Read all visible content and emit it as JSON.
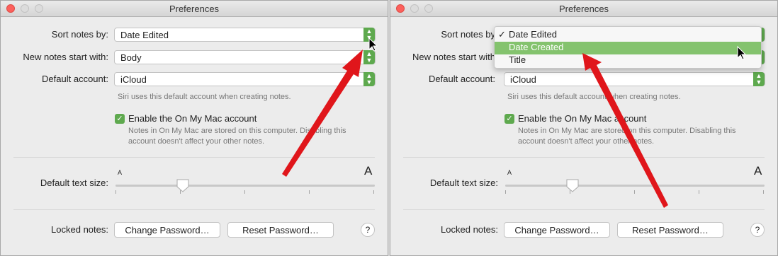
{
  "window": {
    "title": "Preferences"
  },
  "labels": {
    "sort_notes_by": "Sort notes by:",
    "new_notes_start_with": "New notes start with:",
    "default_account": "Default account:",
    "default_text_size": "Default text size:",
    "locked_notes": "Locked notes:"
  },
  "right_labels": {
    "sort_notes_by": "Sort notes by",
    "new_notes_start_with": "New notes start with"
  },
  "values": {
    "sort_notes_by": "Date Edited",
    "new_notes_start_with": "Body",
    "default_account": "iCloud"
  },
  "hints": {
    "account": "Siri uses this default account when creating notes.",
    "on_my_mac_line1": "Notes in On My Mac are stored on this computer. Disabling this",
    "on_my_mac_line2": "account doesn't affect your other notes.",
    "right_on_my_mac_line1": "Notes in On My Mac are stored on this computer. Disabling this",
    "right_on_my_mac_line2": "account doesn't affect your other notes."
  },
  "checkbox": {
    "label": "Enable the On My Mac account",
    "right_label": "Enable the On My Mac account",
    "checked": true
  },
  "text_size": {
    "small_label": "A",
    "large_label": "A",
    "level_fraction": 0.26,
    "tick_count": 5
  },
  "buttons": {
    "change_password": "Change Password…",
    "reset_password": "Reset Password…",
    "help": "?"
  },
  "sort_menu": {
    "items": [
      "Date Edited",
      "Date Created",
      "Title"
    ],
    "checked_item": "Date Edited",
    "highlighted_item": "Date Created",
    "check_mark": "✓"
  },
  "colors": {
    "accent_green": "#5ea94e",
    "highlight_green": "#84c36e",
    "arrow_red": "#e0161b"
  },
  "icons": {
    "stepper": "up-down-chevron-icon",
    "checkbox": "checkmark-icon",
    "cursor": "mouse-pointer-icon",
    "annotation": "red-arrow"
  }
}
